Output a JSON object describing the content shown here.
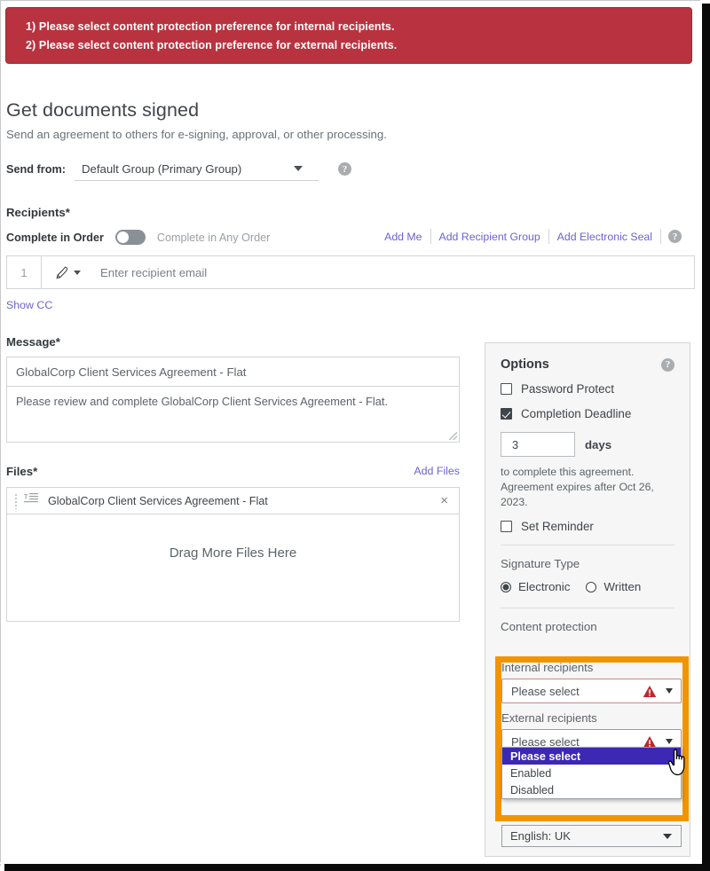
{
  "error_banner": {
    "lines": [
      "1) Please select content protection preference for internal recipients.",
      "2) Please select content protection preference for external recipients."
    ],
    "background_color": "#b8333f"
  },
  "header": {
    "title": "Get documents signed",
    "subtitle": "Send an agreement to others for e-signing, approval, or other processing.",
    "send_from_label": "Send from:",
    "send_from_value": "Default Group (Primary Group)",
    "help_glyph": "?"
  },
  "recipients": {
    "section_label": "Recipients",
    "required_marker": "*",
    "order_label": "Complete in Order",
    "order_alt_label": "Complete in Any Order",
    "toggle_state": "off",
    "links": [
      "Add Me",
      "Add Recipient Group",
      "Add Electronic Seal"
    ],
    "help_glyph": "?",
    "row": {
      "number": "1",
      "role_icon": "signature-pen-icon",
      "email_placeholder": "Enter recipient email"
    },
    "show_cc": "Show CC"
  },
  "message": {
    "section_label": "Message",
    "required_marker": "*",
    "subject": "GlobalCorp Client Services Agreement - Flat",
    "body": "Please review and complete GlobalCorp Client Services Agreement - Flat."
  },
  "files": {
    "section_label": "Files",
    "required_marker": "*",
    "add_files_label": "Add Files",
    "items": [
      {
        "name": "GlobalCorp Client Services Agreement - Flat",
        "remove_glyph": "×"
      }
    ],
    "drop_hint": "Drag More Files Here"
  },
  "options": {
    "title": "Options",
    "help_glyph": "?",
    "password_protect": {
      "label": "Password Protect",
      "checked": false
    },
    "completion_deadline": {
      "label": "Completion Deadline",
      "checked": true
    },
    "days_value": "3",
    "days_unit": "days",
    "note_line1": "to complete this agreement.",
    "note_line2": "Agreement expires after Oct 26, 2023.",
    "set_reminder": {
      "label": "Set Reminder",
      "checked": false
    },
    "signature_type": {
      "title": "Signature Type",
      "electronic_label": "Electronic",
      "written_label": "Written",
      "selected": "Electronic"
    },
    "content_protection": {
      "title": "Content protection",
      "highlight_color": "#f29400",
      "internal": {
        "label": "Internal recipients",
        "value": "Please select",
        "has_error": true
      },
      "external": {
        "label": "External recipients",
        "value": "Please select",
        "has_error": true,
        "dropdown_open": true,
        "options": [
          "Please select",
          "Enabled",
          "Disabled"
        ],
        "highlighted_option": "Please select",
        "highlight_bg": "#3d28b4"
      }
    },
    "language": {
      "value": "English: UK"
    }
  }
}
